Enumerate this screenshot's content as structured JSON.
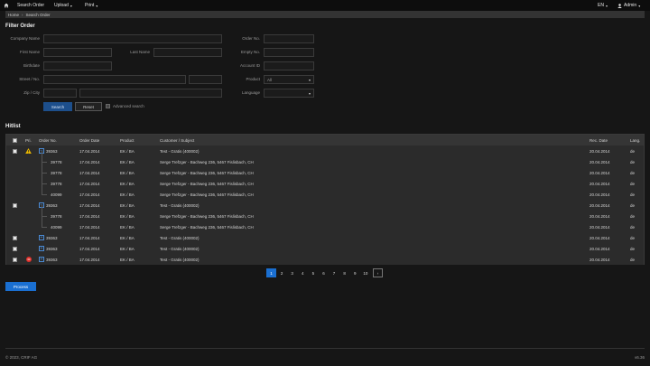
{
  "topbar": {
    "menu": [
      {
        "label": "Search Order",
        "has_caret": false
      },
      {
        "label": "Upload",
        "has_caret": true
      },
      {
        "label": "Print",
        "has_caret": true
      }
    ],
    "language": "EN",
    "user": "Admin"
  },
  "breadcrumb": [
    "Home",
    "Search Order"
  ],
  "filter": {
    "title": "Filter Order",
    "labels": {
      "company_name": "Company Name",
      "first_name": "First Name",
      "last_name": "Last Name",
      "birthdate": "Birthdate",
      "street_no": "Street / No.",
      "zip_city": "Zip / City",
      "order_no": "Order No.",
      "empty_no": "Empty No.",
      "account_id": "Account ID",
      "product": "Product",
      "language": "Language"
    },
    "product_value": "All",
    "language_value": "",
    "search_button": "Search",
    "reset_button": "Reset",
    "advanced_search": "Advanced search"
  },
  "hitlist": {
    "title": "Hitlist",
    "columns": [
      "Pri.",
      "Order No.",
      "Order Date",
      "Product",
      "Customer / Subject",
      "Rec. Date",
      "Lang."
    ],
    "rows": [
      {
        "kind": "group",
        "priority": "warning",
        "expand": "minus",
        "order_no": "39363",
        "date": "17.04.2014",
        "product": "EK / BA",
        "customer": "Test - Gratis (400002)",
        "rec_date": "20.04.2014",
        "lang": "de"
      },
      {
        "kind": "sub",
        "order_no": "39778",
        "date": "17.04.2014",
        "product": "EK / BA",
        "customer": "Serge Trefzger - Bachweg 236, 5467 Fislisbach, CH",
        "rec_date": "20.04.2014",
        "lang": "de"
      },
      {
        "kind": "sub",
        "order_no": "39778",
        "date": "17.04.2014",
        "product": "EK / BA",
        "customer": "Serge Trefzger - Bachweg 236, 5467 Fislisbach, CH",
        "rec_date": "20.04.2014",
        "lang": "de"
      },
      {
        "kind": "sub",
        "order_no": "39778",
        "date": "17.04.2014",
        "product": "EK / BA",
        "customer": "Serge Trefzger - Bachweg 236, 5467 Fislisbach, CH",
        "rec_date": "20.04.2014",
        "lang": "de"
      },
      {
        "kind": "sub",
        "order_no": "40099",
        "date": "17.04.2014",
        "product": "EK / BA",
        "customer": "Serge Trefzger - Bachweg 236, 5467 Fislisbach, CH",
        "rec_date": "20.04.2014",
        "lang": "de"
      },
      {
        "kind": "group",
        "priority": "",
        "expand": "minus",
        "order_no": "39363",
        "date": "17.04.2014",
        "product": "EK / BA",
        "customer": "Test - Gratis (400002)",
        "rec_date": "20.04.2014",
        "lang": "de"
      },
      {
        "kind": "sub",
        "order_no": "39778",
        "date": "17.04.2014",
        "product": "EK / BA",
        "customer": "Serge Trefzger - Bachweg 236, 5467 Fislisbach, CH",
        "rec_date": "20.04.2014",
        "lang": "de"
      },
      {
        "kind": "sub",
        "order_no": "40099",
        "date": "17.04.2014",
        "product": "EK / BA",
        "customer": "Serge Trefzger - Bachweg 236, 5467 Fislisbach, CH",
        "rec_date": "20.04.2014",
        "lang": "de"
      },
      {
        "kind": "group",
        "priority": "",
        "expand": "plus",
        "order_no": "39363",
        "date": "17.04.2014",
        "product": "EK / BA",
        "customer": "Test - Gratis (400002)",
        "rec_date": "20.04.2014",
        "lang": "de"
      },
      {
        "kind": "group",
        "priority": "",
        "expand": "plus",
        "order_no": "39363",
        "date": "17.04.2014",
        "product": "EK / BA",
        "customer": "Test - Gratis (400002)",
        "rec_date": "20.04.2014",
        "lang": "de"
      },
      {
        "kind": "group",
        "priority": "error",
        "expand": "plus",
        "order_no": "39363",
        "date": "17.04.2014",
        "product": "EK / BA",
        "customer": "Test - Gratis (400002)",
        "rec_date": "20.04.2014",
        "lang": "de"
      }
    ]
  },
  "pagination": {
    "pages": [
      "1",
      "2",
      "3",
      "4",
      "5",
      "6",
      "7",
      "8",
      "9",
      "10"
    ],
    "active": "1",
    "next": "›"
  },
  "process_button": "Process",
  "footer": {
    "copyright": "© 2023, CRIF AG",
    "version": "v6.36"
  },
  "colors": {
    "accent": "#1a6fd1",
    "warning": "#e8b600",
    "error": "#e0302a"
  }
}
